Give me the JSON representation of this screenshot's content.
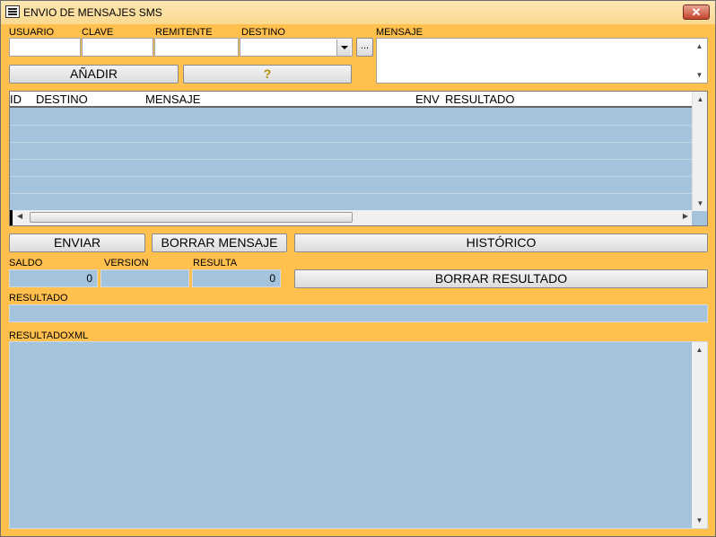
{
  "window": {
    "title": "ENVIO DE MENSAJES SMS",
    "close_label": "✕"
  },
  "form": {
    "usuario_label": "USUARIO",
    "clave_label": "CLAVE",
    "remitente_label": "REMITENTE",
    "destino_label": "DESTINO",
    "mensaje_label": "MENSAJE",
    "usuario_value": "",
    "clave_value": "",
    "remitente_value": "",
    "destino_value": "",
    "mensaje_value": "",
    "browse_label": "..."
  },
  "buttons": {
    "anadir": "AÑADIR",
    "help": "?",
    "enviar": "ENVIAR",
    "borrar_mensaje": "BORRAR MENSAJE",
    "historico": "HISTÓRICO",
    "borrar_resultado": "BORRAR RESULTADO"
  },
  "grid": {
    "columns": [
      "ID",
      "DESTINO",
      "MENSAJE",
      "ENV",
      "RESULTADO"
    ]
  },
  "status": {
    "saldo_label": "SALDO",
    "version_label": "VERSION",
    "resulta_label": "RESULTA",
    "saldo_value": "0",
    "version_value": "",
    "resulta_value": "0",
    "resultado_label": "RESULTADO",
    "resultado_value": "",
    "resultadoxml_label": "RESULTADOXML",
    "resultadoxml_value": ""
  },
  "colors": {
    "background": "#ffc04d",
    "readonly_field": "#a4c4dd",
    "titlebar": "#fbd98f",
    "close_button": "#c3432c"
  }
}
